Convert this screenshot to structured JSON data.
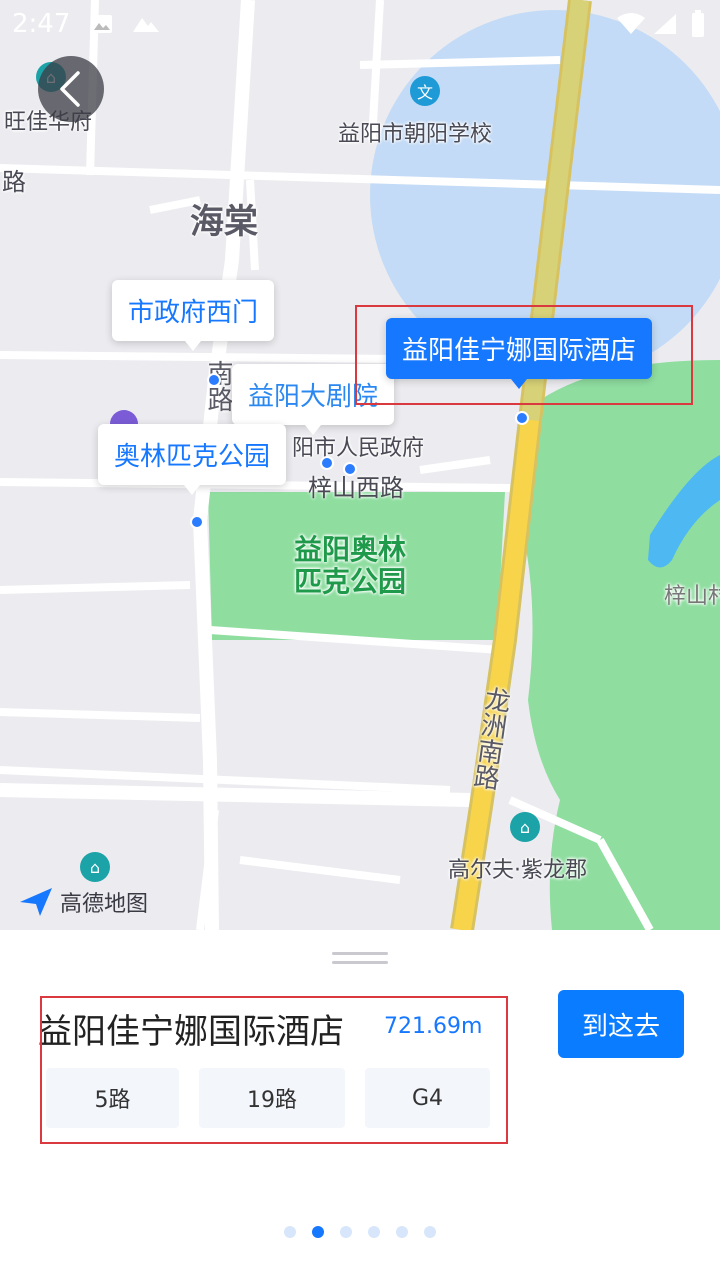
{
  "status_bar": {
    "time": "2:47"
  },
  "map": {
    "labels": {
      "wangjiahuafu": "旺佳华府",
      "lu_left": "路",
      "chaoyang_school": "益阳市朝阳学校",
      "haitang": "海棠",
      "nan_lu_vertical": "南路",
      "people_gov": "阳市人民政府",
      "zishan_west": "梓山西路",
      "olympic_park_area": "益阳奥林\n匹克公园",
      "zishan_right": "梓山村",
      "longzhou_south": "龙洲南路",
      "golf": "高尔夫·紫龙郡",
      "watermark": "高德地图"
    },
    "callouts": {
      "city_hall_west_gate": "市政府西门",
      "grand_theater": "益阳大剧院",
      "olympic_park": "奥林匹克公园",
      "hotel_active": "益阳佳宁娜国际酒店"
    },
    "school_icon_text": "文"
  },
  "sheet": {
    "place_name": "益阳佳宁娜国际酒店",
    "distance": "721.69m",
    "go_button": "到这去",
    "routes": [
      "5路",
      "19路",
      "G4"
    ],
    "pager": {
      "count": 6,
      "active_index": 1
    }
  },
  "colors": {
    "accent": "#1677ff",
    "highlight": "#d9393f",
    "park_green": "#8fdea0",
    "road_yellow": "#f7d44a"
  }
}
